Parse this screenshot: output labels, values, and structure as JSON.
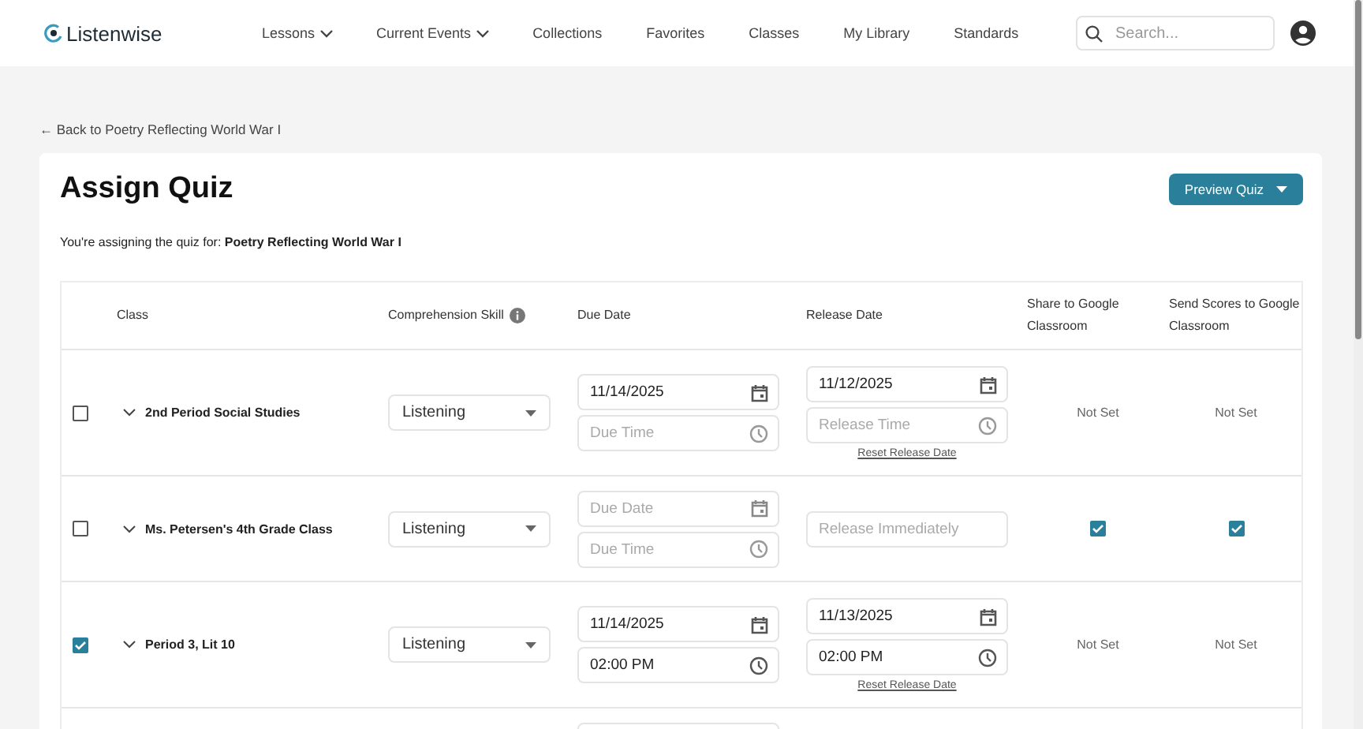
{
  "nav": {
    "logo": "Listenwise",
    "items": [
      {
        "label": "Lessons",
        "dropdown": true
      },
      {
        "label": "Current Events",
        "dropdown": true
      },
      {
        "label": "Collections",
        "dropdown": false
      },
      {
        "label": "Favorites",
        "dropdown": false
      },
      {
        "label": "Classes",
        "dropdown": false
      },
      {
        "label": "My Library",
        "dropdown": false
      },
      {
        "label": "Standards",
        "dropdown": false
      }
    ],
    "search": {
      "placeholder": "Search..."
    }
  },
  "back_link": "← Back to Poetry Reflecting World War I",
  "title": "Assign Quiz",
  "preview_button": "Preview Quiz",
  "subtitle": {
    "text": "You're assigning the quiz for:",
    "lesson": "Poetry Reflecting World War I"
  },
  "table": {
    "columns": [
      "Class",
      "Comprehension Skill",
      "Due Date",
      "Release Date",
      "Share to Google Classroom",
      "Send Scores to Google Classroom"
    ],
    "rows": [
      {
        "checked": false,
        "class": "2nd Period Social Studies",
        "skill": "Listening",
        "due": [
          {
            "kind": "date",
            "value": "11/14/2025"
          },
          {
            "kind": "time",
            "placeholder": "Due Time"
          }
        ],
        "release": [
          {
            "kind": "date",
            "value": "11/12/2025"
          },
          {
            "kind": "time",
            "placeholder": "Release Time"
          }
        ],
        "reset_link": "Reset Release Date",
        "share": {
          "kind": "text",
          "text": "Not Set"
        },
        "send": {
          "kind": "text",
          "text": "Not Set"
        }
      },
      {
        "checked": false,
        "class": "Ms. Petersen's 4th Grade Class",
        "skill": "Listening",
        "due": [
          {
            "kind": "date",
            "placeholder": "Due Date"
          },
          {
            "kind": "time",
            "placeholder": "Due Time"
          }
        ],
        "release": [
          {
            "kind": "plain",
            "placeholder": "Release Immediately"
          }
        ],
        "share": {
          "kind": "checkbox",
          "checked": true
        },
        "send": {
          "kind": "checkbox",
          "checked": true
        }
      },
      {
        "checked": true,
        "class": "Period 3, Lit 10",
        "skill": "Listening",
        "due": [
          {
            "kind": "date",
            "value": "11/14/2025"
          },
          {
            "kind": "time",
            "value": "02:00 PM"
          }
        ],
        "release": [
          {
            "kind": "date",
            "value": "11/13/2025"
          },
          {
            "kind": "time",
            "value": "02:00 PM"
          }
        ],
        "reset_link": "Reset Release Date",
        "share": {
          "kind": "text",
          "text": "Not Set"
        },
        "send": {
          "kind": "text",
          "text": "Not Set"
        }
      }
    ]
  }
}
